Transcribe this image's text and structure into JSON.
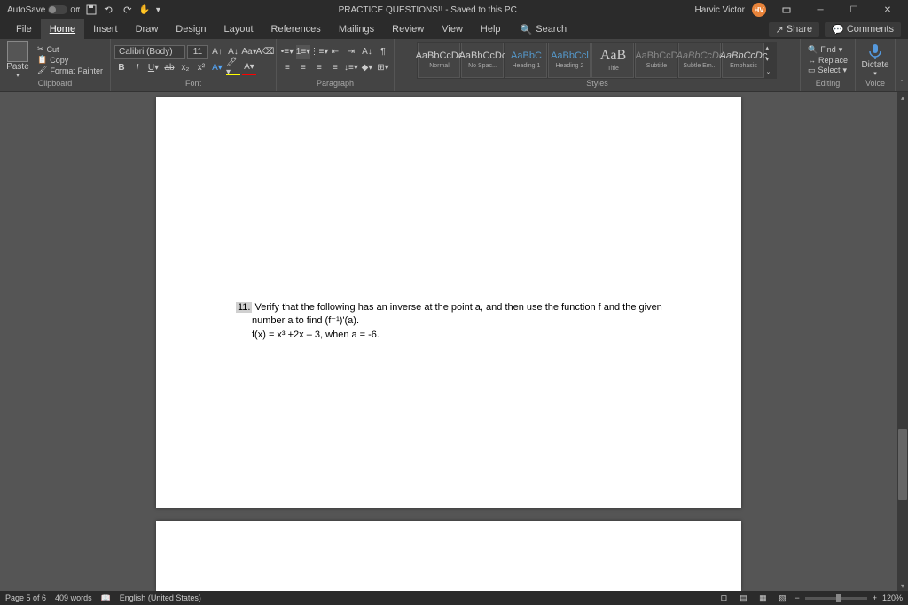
{
  "titlebar": {
    "autosave_label": "AutoSave",
    "autosave_state": "Off",
    "doc_title": "PRACTICE QUESTIONS!! - Saved to this PC",
    "username": "Harvic Victor",
    "user_initials": "HV"
  },
  "tabs": {
    "file": "File",
    "home": "Home",
    "insert": "Insert",
    "draw": "Draw",
    "design": "Design",
    "layout": "Layout",
    "references": "References",
    "mailings": "Mailings",
    "review": "Review",
    "view": "View",
    "help": "Help",
    "search": "Search",
    "share": "Share",
    "comments": "Comments"
  },
  "ribbon": {
    "clipboard": {
      "paste": "Paste",
      "cut": "Cut",
      "copy": "Copy",
      "format_painter": "Format Painter",
      "label": "Clipboard"
    },
    "font": {
      "name": "Calibri (Body)",
      "size": "11",
      "label": "Font"
    },
    "paragraph": {
      "label": "Paragraph"
    },
    "styles": {
      "items": [
        {
          "preview": "AaBbCcDc",
          "name": "Normal"
        },
        {
          "preview": "AaBbCcDc",
          "name": "No Spac..."
        },
        {
          "preview": "AaBbC",
          "name": "Heading 1"
        },
        {
          "preview": "AaBbCcl",
          "name": "Heading 2"
        },
        {
          "preview": "AaB",
          "name": "Title"
        },
        {
          "preview": "AaBbCcD",
          "name": "Subtitle"
        },
        {
          "preview": "AaBbCcDc",
          "name": "Subtle Em..."
        },
        {
          "preview": "AaBbCcDc",
          "name": "Emphasis"
        }
      ],
      "label": "Styles"
    },
    "editing": {
      "find": "Find",
      "replace": "Replace",
      "select": "Select",
      "label": "Editing"
    },
    "voice": {
      "dictate": "Dictate",
      "label": "Voice"
    }
  },
  "document": {
    "q_num": "11.",
    "line1": "Verify that the following has an inverse at the point a, and then use the function f and the given",
    "line2": "number a to find (f⁻¹)'(a).",
    "line3": "f(x) = x³ +2x – 3, when a = -6."
  },
  "statusbar": {
    "page": "Page 5 of 6",
    "words": "409 words",
    "language": "English (United States)",
    "zoom": "120%"
  }
}
